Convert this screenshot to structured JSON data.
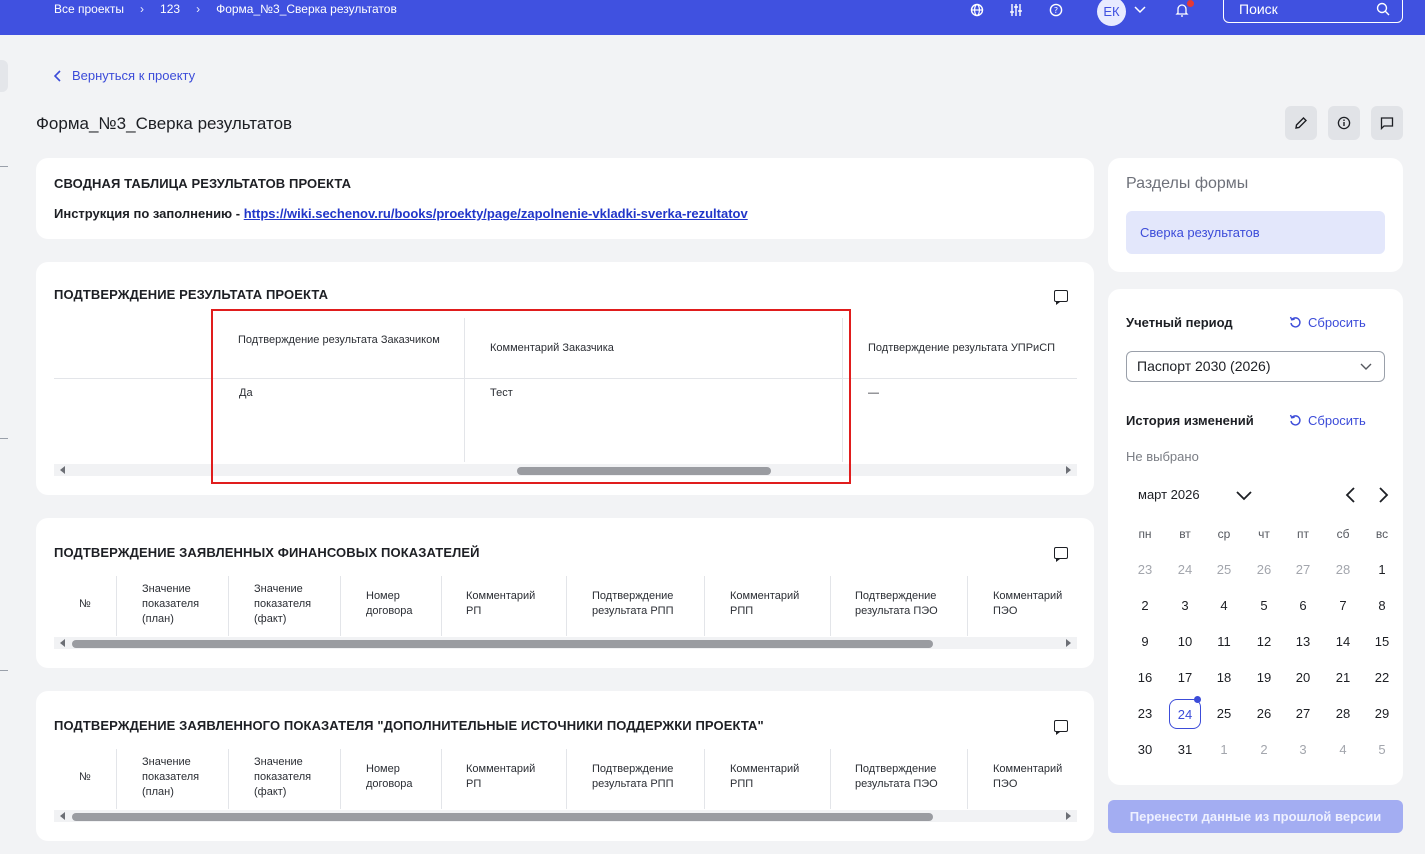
{
  "breadcrumbs": [
    "Все проекты",
    "123",
    "Форма_№3_Сверка результатов"
  ],
  "topbar": {
    "avatar_initials": "ЕК",
    "search_placeholder": "Поиск",
    "icons": [
      "globe-icon",
      "sliders-icon",
      "help-icon",
      "chevron-down-icon",
      "bell-icon",
      "search-icon"
    ]
  },
  "back_link": "Вернуться к проекту",
  "page_title": "Форма_№3_Сверка результатов",
  "actions": [
    "edit-icon",
    "info-icon",
    "comment-icon"
  ],
  "summary": {
    "title": "СВОДНАЯ ТАБЛИЦА РЕЗУЛЬТАТОВ ПРОЕКТА",
    "instruction_label": "Инструкция по заполнению - ",
    "instruction_link": "https://wiki.sechenov.ru/books/proekty/page/zapolnenie-vkladki-sverka-rezultatov"
  },
  "result": {
    "title": "ПОДТВЕРЖДЕНИЕ РЕЗУЛЬТАТА ПРОЕКТА",
    "columns": [
      "Подтверждение результата Заказчиком",
      "Комментарий Заказчика",
      "Подтверждение результата УПРиСП"
    ],
    "row": [
      "Да",
      "Тест",
      "—"
    ]
  },
  "finance": {
    "title": "ПОДТВЕРЖДЕНИЕ ЗАЯВЛЕННЫХ ФИНАНСОВЫХ ПОКАЗАТЕЛЕЙ",
    "columns": [
      "№",
      "Значение показателя (план)",
      "Значение показателя (факт)",
      "Номер договора",
      "Комментарий РП",
      "Подтверждение результата РПП",
      "Комментарий РПП",
      "Подтверждение результата ПЭО",
      "Комментарий ПЭО"
    ]
  },
  "additional": {
    "title": "ПОДТВЕРЖДЕНИЕ ЗАЯВЛЕННОГО ПОКАЗАТЕЛЯ \"ДОПОЛНИТЕЛЬНЫЕ ИСТОЧНИКИ ПОДДЕРЖКИ ПРОЕКТА\"",
    "columns": [
      "№",
      "Значение показателя (план)",
      "Значение показателя (факт)",
      "Номер договора",
      "Комментарий РП",
      "Подтверждение результата РПП",
      "Комментарий РПП",
      "Подтверждение результата ПЭО",
      "Комментарий ПЭО"
    ]
  },
  "sidebar": {
    "title": "Разделы формы",
    "section": "Сверка результатов",
    "period_label": "Учетный период",
    "reset_label": "Сбросить",
    "period_value": "Паспорт 2030 (2026)",
    "history_label": "История изменений",
    "history_value": "Не выбрано",
    "month": "март 2026",
    "weekdays": [
      "пн",
      "вт",
      "ср",
      "чт",
      "пт",
      "сб",
      "вс"
    ],
    "today": "24"
  },
  "calendar_days": [
    [
      "23",
      "24",
      "25",
      "26",
      "27",
      "28",
      "1"
    ],
    [
      "2",
      "3",
      "4",
      "5",
      "6",
      "7",
      "8"
    ],
    [
      "9",
      "10",
      "11",
      "12",
      "13",
      "14",
      "15"
    ],
    [
      "16",
      "17",
      "18",
      "19",
      "20",
      "21",
      "22"
    ],
    [
      "23",
      "24",
      "25",
      "26",
      "27",
      "28",
      "29"
    ],
    [
      "30",
      "31",
      "1",
      "2",
      "3",
      "4",
      "5"
    ]
  ],
  "primary_button": "Перенести данные из прошлой версии"
}
